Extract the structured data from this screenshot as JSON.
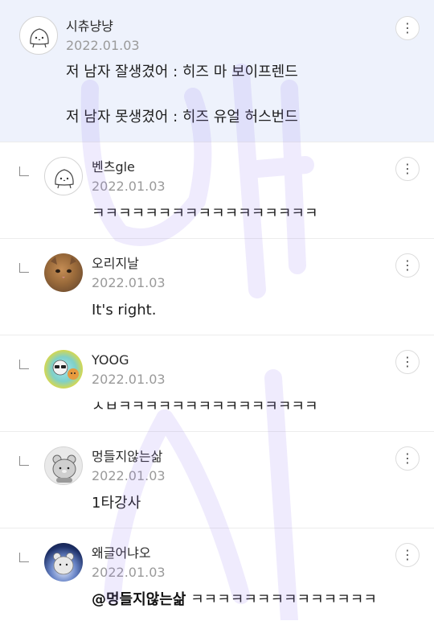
{
  "comments": [
    {
      "author": "시츄냥냥",
      "date": "2022.01.03",
      "lines": [
        "저 남자 잘생겼어 : 히즈 마 보이프렌드",
        "저 남자 못생겼어 : 히즈 유얼 허스번드"
      ],
      "avatar": "ghost-icon"
    }
  ],
  "replies": [
    {
      "author": "벤츠gle",
      "date": "2022.01.03",
      "text": "ㅋㅋㅋㅋㅋㅋㅋㅋㅋㅋㅋㅋㅋㅋㅋㅋㅋ",
      "avatar": "ghost-icon"
    },
    {
      "author": "오리지날",
      "date": "2022.01.03",
      "text": "It's right.",
      "avatar": "cat-photo"
    },
    {
      "author": "YOOG",
      "date": "2022.01.03",
      "text": "ㅅㅂㅋㅋㅋㅋㅋㅋㅋㅋㅋㅋㅋㅋㅋㅋㅋ",
      "avatar": "character-avatar"
    },
    {
      "author": "멍들지않는삶",
      "date": "2022.01.03",
      "text": "1타강사",
      "avatar": "bear-icon"
    },
    {
      "author": "왜글어냐오",
      "date": "2022.01.03",
      "mention": "@멍들지않는삶",
      "text": " ㅋㅋㅋㅋㅋㅋㅋㅋㅋㅋㅋㅋㅋㅋ",
      "avatar": "bear-icon"
    }
  ],
  "more_label": "⋮",
  "colors": {
    "highlight_bg": "#eef2fc",
    "date": "#9a9a9a",
    "watermark": "#8c6cf0"
  }
}
